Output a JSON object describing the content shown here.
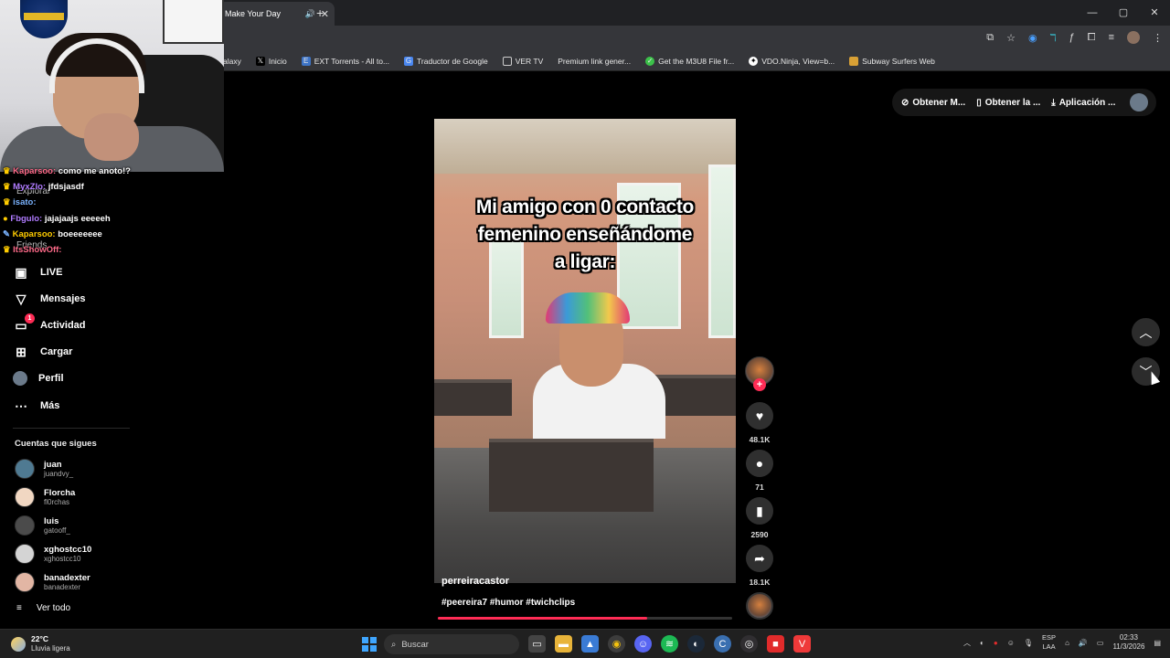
{
  "browser": {
    "tab_title": "Make Your Day",
    "window_controls": [
      "—",
      "▢",
      "✕"
    ],
    "bookmarks": [
      {
        "label": "alaxy",
        "icon": "star-icon",
        "color": "#35363a"
      },
      {
        "label": "Inicio",
        "icon": "x-logo-icon",
        "color": "#000000"
      },
      {
        "label": "EXT Torrents - All to...",
        "icon": "ext-icon",
        "color": "#3d74c7"
      },
      {
        "label": "Traductor de Google",
        "icon": "translate-icon",
        "color": "#4a87f0"
      },
      {
        "label": "VER TV",
        "icon": "folder-icon",
        "color": "#35363a"
      },
      {
        "label": "Premium link gener...",
        "icon": "link-icon",
        "color": "#35363a"
      },
      {
        "label": "Get the M3U8 File fr...",
        "icon": "check-icon",
        "color": "#3cc24a"
      },
      {
        "label": "VDO.Ninja, View=b...",
        "icon": "ninja-icon",
        "color": "#ffffff"
      },
      {
        "label": "Subway Surfers Web",
        "icon": "game-icon",
        "color": "#d8a035"
      }
    ]
  },
  "chat": [
    {
      "user": "Kaparsoo:",
      "msg": "como me anoto!?",
      "color": "u3"
    },
    {
      "user": "MyxZIo:",
      "msg": "jfdsjasdf",
      "color": "u1"
    },
    {
      "user": "isato:",
      "msg": "",
      "color": "u4"
    },
    {
      "user": "Fbgulo:",
      "msg": "jajajaajs eeeeeh",
      "color": "u1"
    },
    {
      "user": "Kaparsoo:",
      "msg": "boeeeeeee",
      "color": "u2"
    },
    {
      "user": "ItsShowOff:",
      "msg": "",
      "color": "u3"
    }
  ],
  "sidebar": {
    "ghost_items": [
      "Explorar",
      "Friends"
    ],
    "nav": [
      {
        "label": "LIVE",
        "icon": "live-icon",
        "glyph": "▣"
      },
      {
        "label": "Mensajes",
        "icon": "messages-icon",
        "glyph": "▽"
      },
      {
        "label": "Actividad",
        "icon": "activity-icon",
        "glyph": "▭",
        "badge": "1"
      },
      {
        "label": "Cargar",
        "icon": "upload-icon",
        "glyph": "⊞"
      },
      {
        "label": "Perfil",
        "icon": "profile-icon",
        "glyph": "●"
      },
      {
        "label": "Más",
        "icon": "more-icon",
        "glyph": "⋯"
      }
    ],
    "following_title": "Cuentas que sigues",
    "following": [
      {
        "name": "juan",
        "handle": "juandvy_",
        "color": "#4f7a92"
      },
      {
        "name": "Florcha",
        "handle": "fl0rchas",
        "color": "#f1d7c2"
      },
      {
        "name": "luis",
        "handle": "gatooff_",
        "color": "#4b4b4b"
      },
      {
        "name": "xghostcc10",
        "handle": "xghostcc10",
        "color": "#d4d4d4"
      },
      {
        "name": "banadexter",
        "handle": "banadexter",
        "color": "#e2b6a4"
      }
    ],
    "see_all": "Ver todo"
  },
  "top_actions": [
    "Obtener M...",
    "Obtener la ...",
    "Aplicación ..."
  ],
  "video": {
    "caption_lines": [
      "Mi amigo con 0 contacto",
      "femenino enseñándome",
      "a ligar:"
    ],
    "author": "perreiracastor",
    "hashtags": "#peereira7 #humor #twichclips",
    "progress": 0.71,
    "likes": "48.1K",
    "comments": "71",
    "saves": "2590",
    "shares": "18.1K"
  },
  "taskbar": {
    "temp": "22°C",
    "weather": "Lluvia ligera",
    "search_placeholder": "Buscar",
    "lang_line1": "ESP",
    "lang_line2": "LAA",
    "time": "02:33",
    "date": "11/3/2026"
  }
}
